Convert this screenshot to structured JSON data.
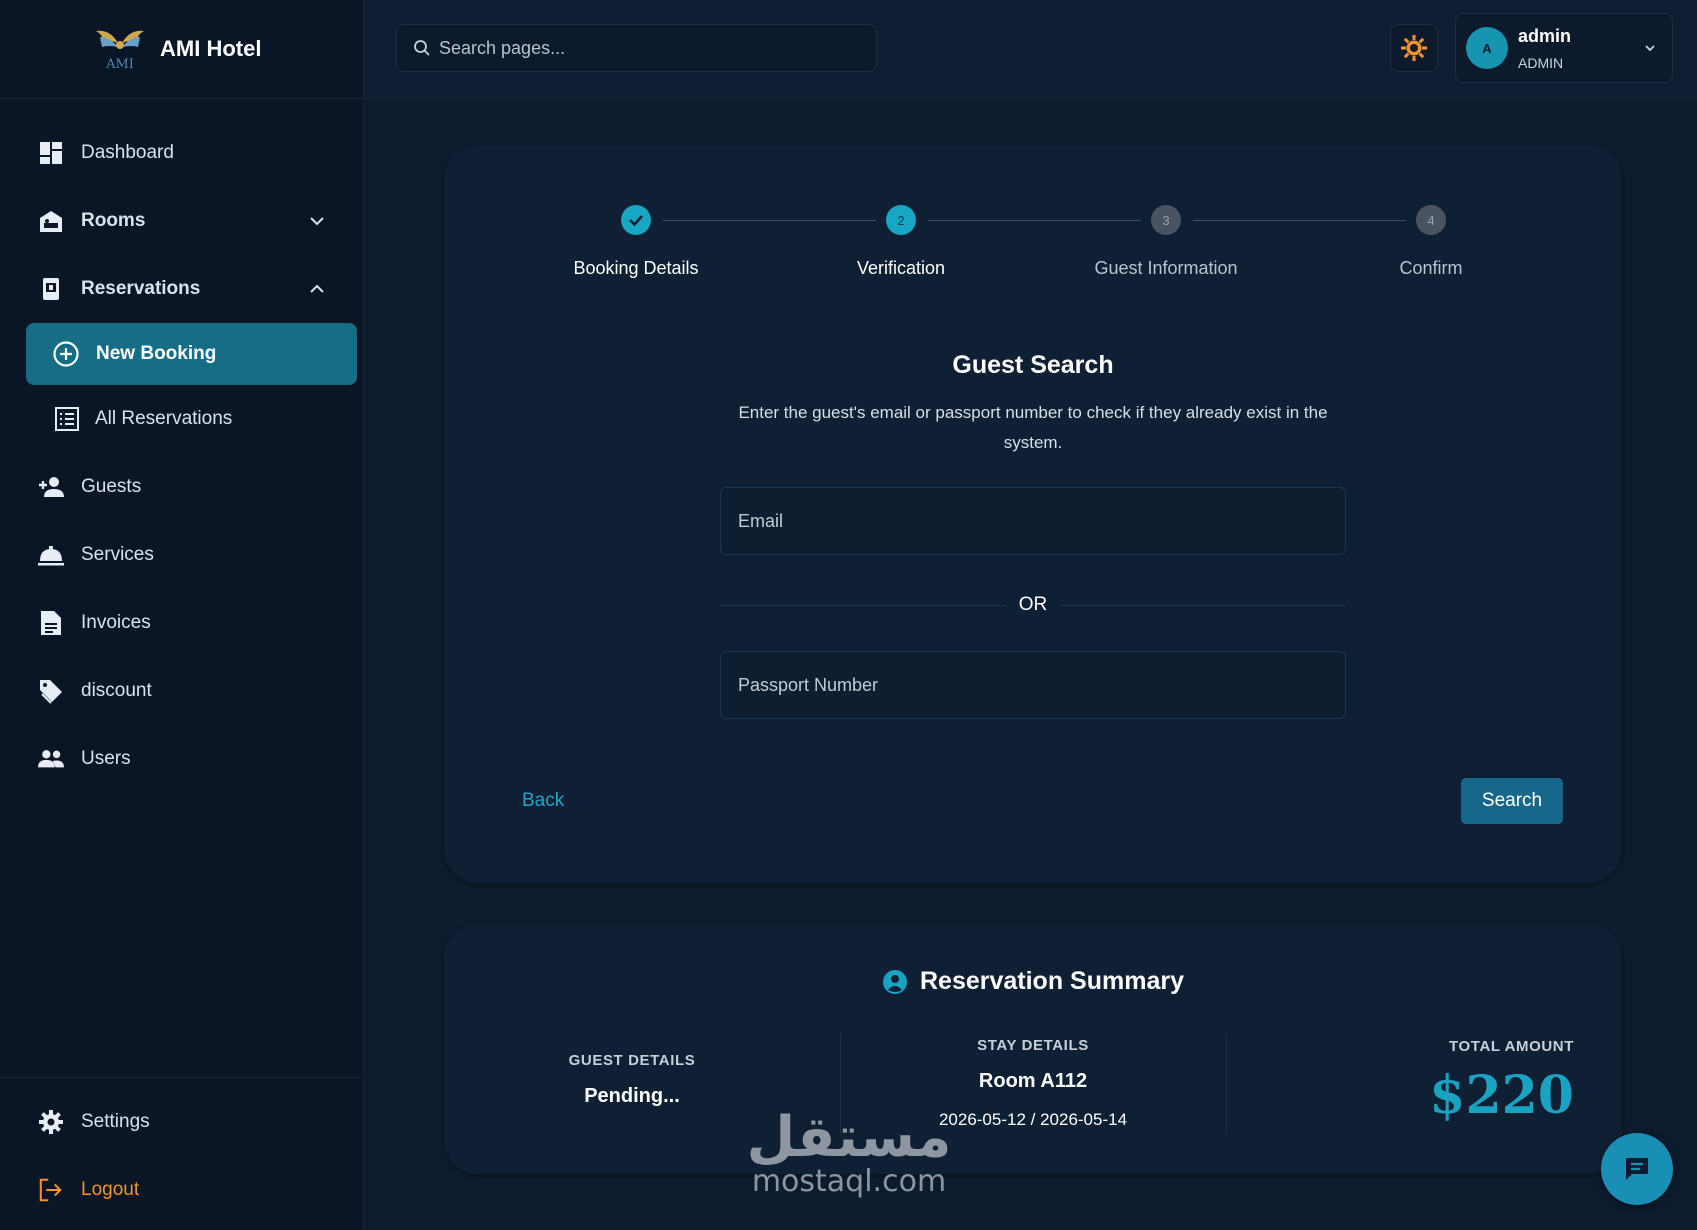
{
  "brand": {
    "name": "AMI Hotel",
    "logo_text": "AMI"
  },
  "sidebar": {
    "items": [
      {
        "label": "Dashboard",
        "icon": "dashboard-icon"
      },
      {
        "label": "Rooms",
        "icon": "bed-icon"
      },
      {
        "label": "Reservations",
        "icon": "reservations-icon"
      },
      {
        "label": "New Booking",
        "icon": "plus-circle-icon"
      },
      {
        "label": "All Reservations",
        "icon": "list-icon"
      },
      {
        "label": "Guests",
        "icon": "add-person-icon"
      },
      {
        "label": "Services",
        "icon": "room-service-icon"
      },
      {
        "label": "Invoices",
        "icon": "document-icon"
      },
      {
        "label": "discount",
        "icon": "tag-icon"
      },
      {
        "label": "Users",
        "icon": "users-icon"
      }
    ],
    "bottom": [
      {
        "label": "Settings",
        "icon": "gear-icon"
      },
      {
        "label": "Logout",
        "icon": "logout-icon"
      }
    ]
  },
  "topbar": {
    "search_placeholder": "Search pages...",
    "user_name": "admin",
    "user_role": "ADMIN",
    "avatar_initial": "A"
  },
  "stepper": {
    "steps": [
      {
        "label": "Booking Details",
        "number": "",
        "state": "done"
      },
      {
        "label": "Verification",
        "number": "2",
        "state": "current"
      },
      {
        "label": "Guest Information",
        "number": "3",
        "state": "pending"
      },
      {
        "label": "Confirm",
        "number": "4",
        "state": "pending"
      }
    ]
  },
  "guest_search": {
    "title": "Guest Search",
    "description": "Enter the guest's email or passport number to check if they already exist in the system.",
    "email_placeholder": "Email",
    "or_label": "OR",
    "passport_placeholder": "Passport Number",
    "back_label": "Back",
    "search_label": "Search"
  },
  "summary": {
    "title": "Reservation Summary",
    "guest_label": "GUEST DETAILS",
    "guest_value": "Pending...",
    "stay_label": "STAY DETAILS",
    "stay_room": "Room A112",
    "stay_dates": "2026-05-12 / 2026-05-14",
    "total_label": "TOTAL AMOUNT",
    "total_value": "$220"
  },
  "watermark": {
    "arabic": "مستقل",
    "latin": "mostaql.com"
  },
  "colors": {
    "accent": "#166e86",
    "link": "#24a7c6",
    "logout": "#f5922b",
    "theme_icon": "#f5922b"
  }
}
